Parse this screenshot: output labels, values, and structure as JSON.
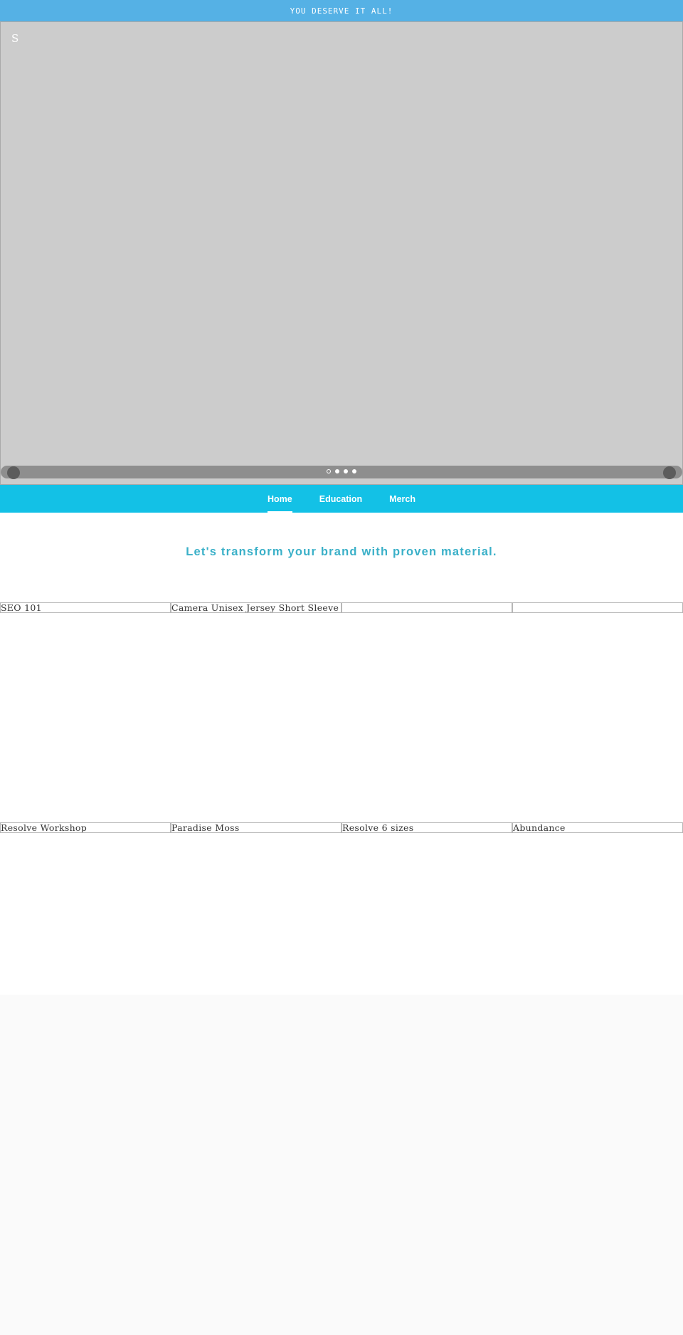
{
  "announcement": {
    "text": "YOU DESERVE IT ALL!"
  },
  "hero": {
    "letter": "S",
    "prev_icon": "",
    "next_icon": "",
    "slide_count": 4,
    "active_slide": 1
  },
  "nav": {
    "items": [
      {
        "label": "Home",
        "active": true
      },
      {
        "label": "Education",
        "active": false
      },
      {
        "label": "Merch",
        "active": false
      }
    ]
  },
  "tagline": "Let's transform your brand with proven material.",
  "products": {
    "row1": [
      "SEO 101",
      "Camera Unisex Jersey Short Sleeve Tee",
      "",
      ""
    ],
    "row2": [
      "Resolve Workshop",
      "Paradise Moss",
      "Resolve 6 sizes",
      "Abundance"
    ]
  },
  "colors": {
    "announcement_bg": "#55b1e5",
    "nav_bg": "#13c1e6",
    "tagline": "#3ab0c8",
    "hero_bg": "#cccccc",
    "footer_bg": "#fafafa"
  }
}
